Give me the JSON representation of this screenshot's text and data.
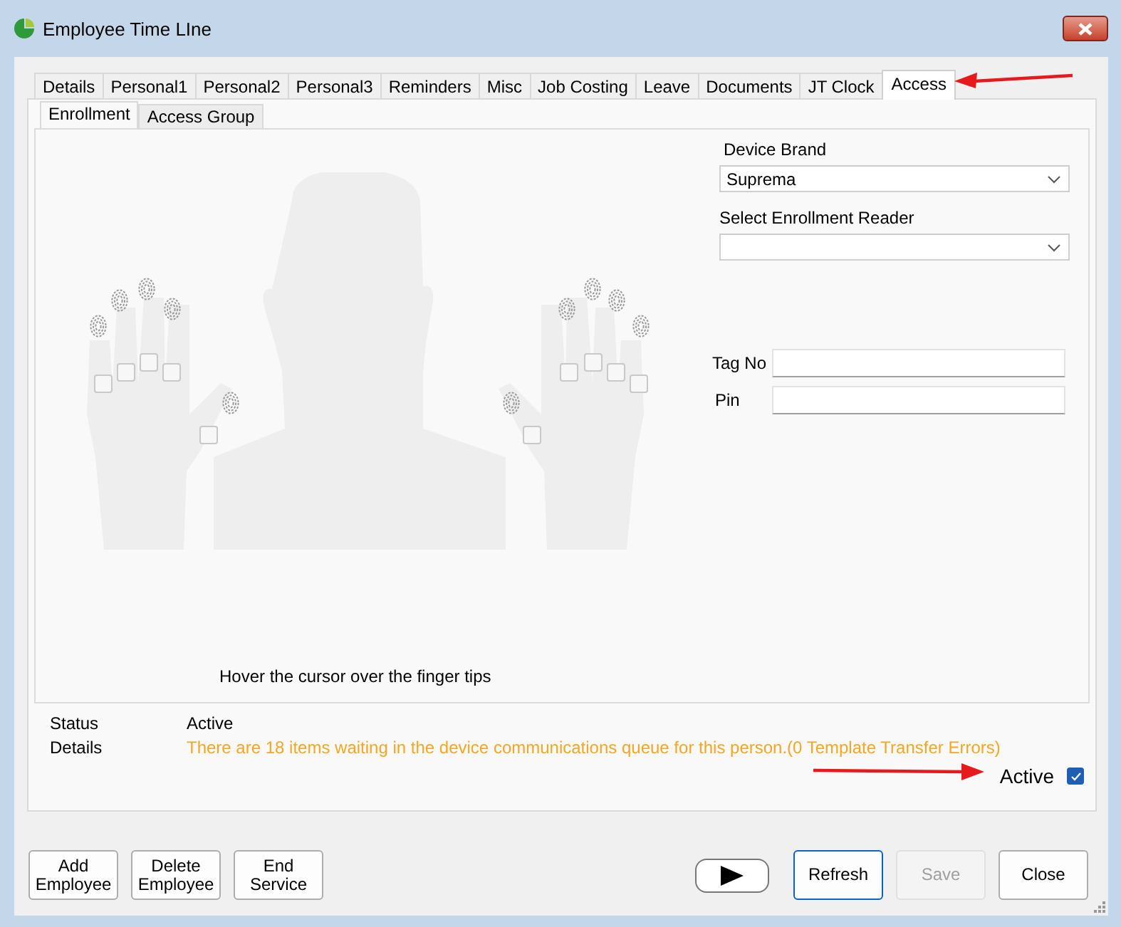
{
  "window": {
    "title": "Employee Time LIne"
  },
  "tabs": [
    {
      "label": "Details",
      "selected": false
    },
    {
      "label": "Personal1",
      "selected": false
    },
    {
      "label": "Personal2",
      "selected": false
    },
    {
      "label": "Personal3",
      "selected": false
    },
    {
      "label": "Reminders",
      "selected": false
    },
    {
      "label": "Misc",
      "selected": false
    },
    {
      "label": "Job Costing",
      "selected": false
    },
    {
      "label": "Leave",
      "selected": false
    },
    {
      "label": "Documents",
      "selected": false
    },
    {
      "label": "JT Clock",
      "selected": false
    },
    {
      "label": "Access",
      "selected": true
    }
  ],
  "subtabs": [
    {
      "label": "Enrollment",
      "selected": true
    },
    {
      "label": "Access Group",
      "selected": false
    }
  ],
  "fingers": [
    {
      "checked": false
    },
    {
      "checked": false
    },
    {
      "checked": false
    },
    {
      "checked": false
    },
    {
      "checked": false
    },
    {
      "checked": false
    },
    {
      "checked": false
    },
    {
      "checked": false
    },
    {
      "checked": false
    },
    {
      "checked": false
    }
  ],
  "hint": "Hover the cursor over the finger tips",
  "device_brand": {
    "label": "Device Brand",
    "value": "Suprema"
  },
  "enrollment_reader": {
    "label": "Select Enrollment Reader"
  },
  "tag_no": {
    "label": "Tag No"
  },
  "pin": {
    "label": "Pin"
  },
  "status_rows": [
    {
      "label": "Status",
      "value": "Active",
      "kind": "normal"
    },
    {
      "label": "Details",
      "value": "There are 18 items waiting in the device communications queue for this person.(0 Template Transfer Errors)",
      "kind": "warning"
    }
  ],
  "active": {
    "label": "Active",
    "checked": true
  },
  "left_buttons": [
    {
      "label": "Add\nEmployee"
    },
    {
      "label": "Delete\nEmployee"
    },
    {
      "label": "End\nService"
    }
  ],
  "right_buttons": [
    {
      "kind": "play"
    },
    {
      "kind": "text",
      "label": "Refresh",
      "disabled": false,
      "focused": true
    },
    {
      "kind": "text",
      "label": "Save",
      "disabled": true,
      "focused": false
    },
    {
      "kind": "text",
      "label": "Close",
      "disabled": false,
      "focused": false
    }
  ]
}
